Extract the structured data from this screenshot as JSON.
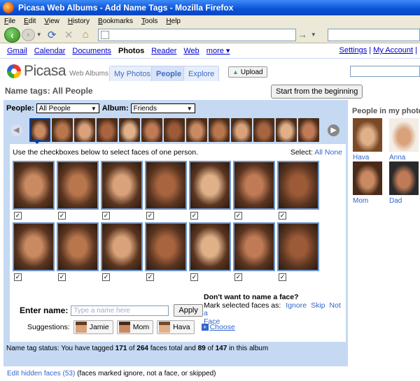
{
  "window": {
    "title": "Picasa Web Albums - Add Name Tags - Mozilla Firefox"
  },
  "menu": [
    "File",
    "Edit",
    "View",
    "History",
    "Bookmarks",
    "Tools",
    "Help"
  ],
  "gbar": {
    "links": [
      "Gmail",
      "Calendar",
      "Documents"
    ],
    "current": "Photos",
    "links2": [
      "Reader",
      "Web"
    ],
    "more": "more ▾",
    "settings": "Settings",
    "sep": "|",
    "account": "My Account",
    "sep2": "|"
  },
  "header": {
    "logo": "Picasa",
    "logo_sub": "Web Albums",
    "tabs": [
      "My Photos",
      "People",
      "Explore"
    ],
    "active_tab": "People",
    "upload": "Upload"
  },
  "page": {
    "title": "Name tags: All People",
    "start_button": "Start from the beginning"
  },
  "filters": {
    "people_label": "People:",
    "people_value": "All People",
    "album_label": "Album:",
    "album_value": "Friends"
  },
  "grid": {
    "instruction": "Use the checkboxes below to select faces of one person.",
    "select_label": "Select:",
    "select_all": "All",
    "select_none": "None",
    "check_mark": "✓"
  },
  "entry": {
    "label": "Enter name:",
    "placeholder": "Type a name here",
    "apply": "Apply",
    "dont_want_title": "Don't want to name a face?",
    "mark_as": "Mark selected faces as:",
    "ignore": "Ignore",
    "skip": "Skip",
    "not_a": "Not a",
    "face": "Face"
  },
  "suggestions": {
    "label": "Suggestions:",
    "names": [
      "Jamie",
      "Mom",
      "Hava"
    ],
    "choose": "Choose"
  },
  "status": {
    "prefix": "Name tag status:  You have tagged",
    "tagged": "171",
    "of": "of",
    "total": "264",
    "mid": "faces total and",
    "album_tagged": "89",
    "of2": "of",
    "album_total": "147",
    "suffix": "in this album"
  },
  "hidden": {
    "link": "Edit hidden faces (53)",
    "note": "(faces marked ignore, not a face, or skipped)"
  },
  "sidebar": {
    "title": "People in my photos",
    "people": [
      "Hava",
      "Anna",
      "Mom",
      "Dad"
    ]
  },
  "colors": {
    "panel": "#c5d9f3",
    "face_border": "#6f97cf",
    "link": "#3366cc",
    "skin_tones": [
      "#c98a62",
      "#b8764d",
      "#d9a27a",
      "#a8643f",
      "#e0b089",
      "#c07a55",
      "#9c5a38"
    ]
  }
}
